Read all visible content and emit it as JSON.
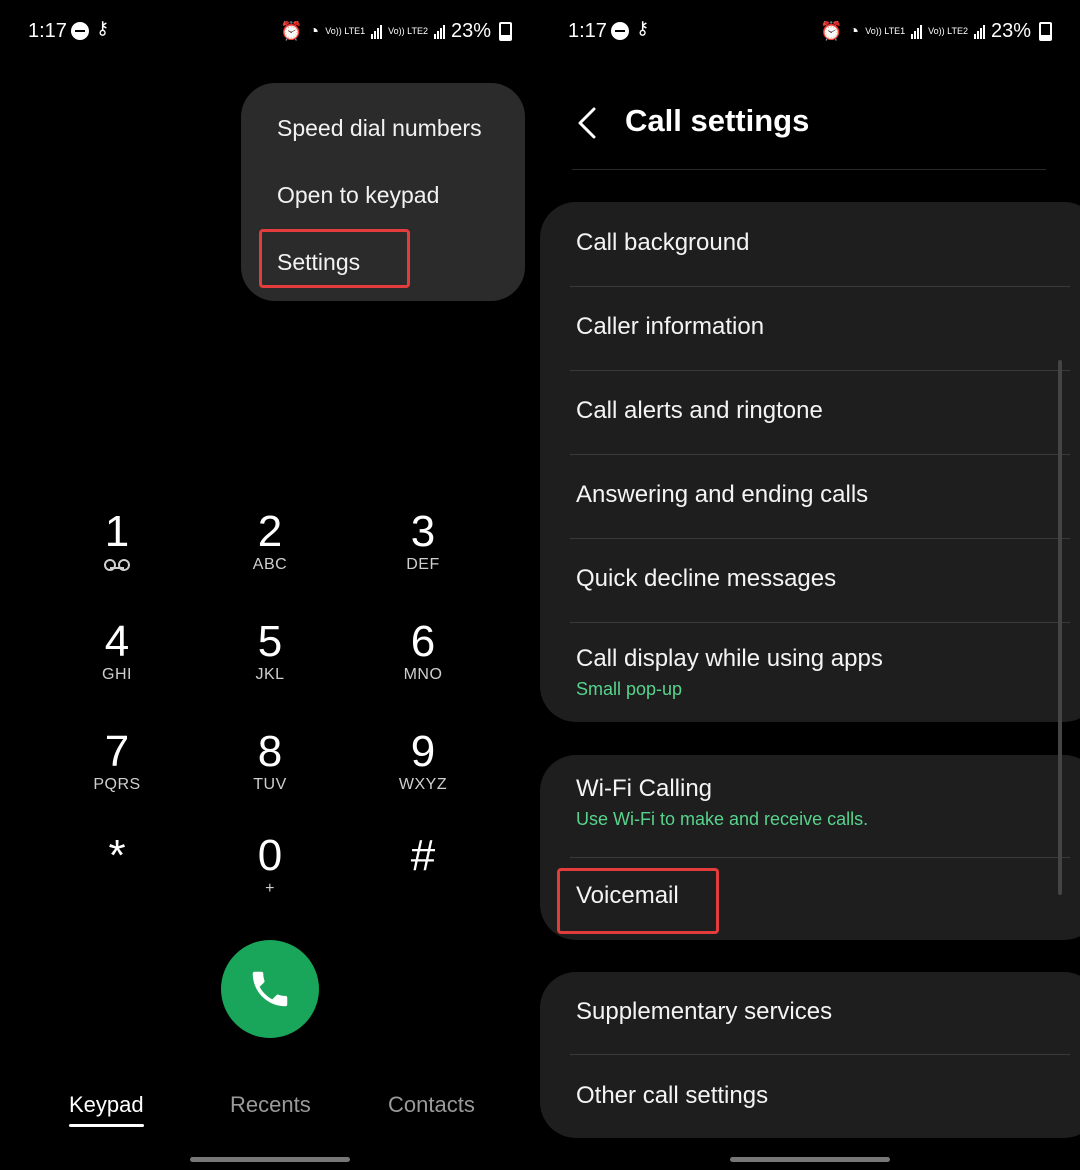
{
  "status": {
    "time": "1:17",
    "battery": "23%",
    "volte1": "Vo)) LTE1",
    "volte2": "Vo)) LTE2"
  },
  "menu": {
    "items": [
      "Speed dial numbers",
      "Open to keypad",
      "Settings"
    ],
    "highlighted": "Settings"
  },
  "keypad": {
    "keys": [
      {
        "digit": "1",
        "letters": ""
      },
      {
        "digit": "2",
        "letters": "ABC"
      },
      {
        "digit": "3",
        "letters": "DEF"
      },
      {
        "digit": "4",
        "letters": "GHI"
      },
      {
        "digit": "5",
        "letters": "JKL"
      },
      {
        "digit": "6",
        "letters": "MNO"
      },
      {
        "digit": "7",
        "letters": "PQRS"
      },
      {
        "digit": "8",
        "letters": "TUV"
      },
      {
        "digit": "9",
        "letters": "WXYZ"
      },
      {
        "digit": "*",
        "letters": ""
      },
      {
        "digit": "0",
        "letters": "+"
      },
      {
        "digit": "#",
        "letters": ""
      }
    ],
    "call_icon": "phone-icon",
    "call_color": "#1aa65a"
  },
  "tabs": {
    "keypad": "Keypad",
    "recents": "Recents",
    "contacts": "Contacts",
    "active": "Keypad"
  },
  "settings": {
    "title": "Call settings",
    "group1": [
      {
        "title": "Call background",
        "subtitle": ""
      },
      {
        "title": "Caller information",
        "subtitle": ""
      },
      {
        "title": "Call alerts and ringtone",
        "subtitle": ""
      },
      {
        "title": "Answering and ending calls",
        "subtitle": ""
      },
      {
        "title": "Quick decline messages",
        "subtitle": ""
      },
      {
        "title": "Call display while using apps",
        "subtitle": "Small pop-up"
      }
    ],
    "group2": [
      {
        "title": "Wi-Fi Calling",
        "subtitle": "Use Wi-Fi to make and receive calls."
      },
      {
        "title": "Voicemail",
        "subtitle": ""
      }
    ],
    "group3": [
      {
        "title": "Supplementary services",
        "subtitle": ""
      },
      {
        "title": "Other call settings",
        "subtitle": ""
      }
    ],
    "highlighted": "Voicemail",
    "accent_color": "#57d38c",
    "highlight_color": "#e23c3c"
  }
}
